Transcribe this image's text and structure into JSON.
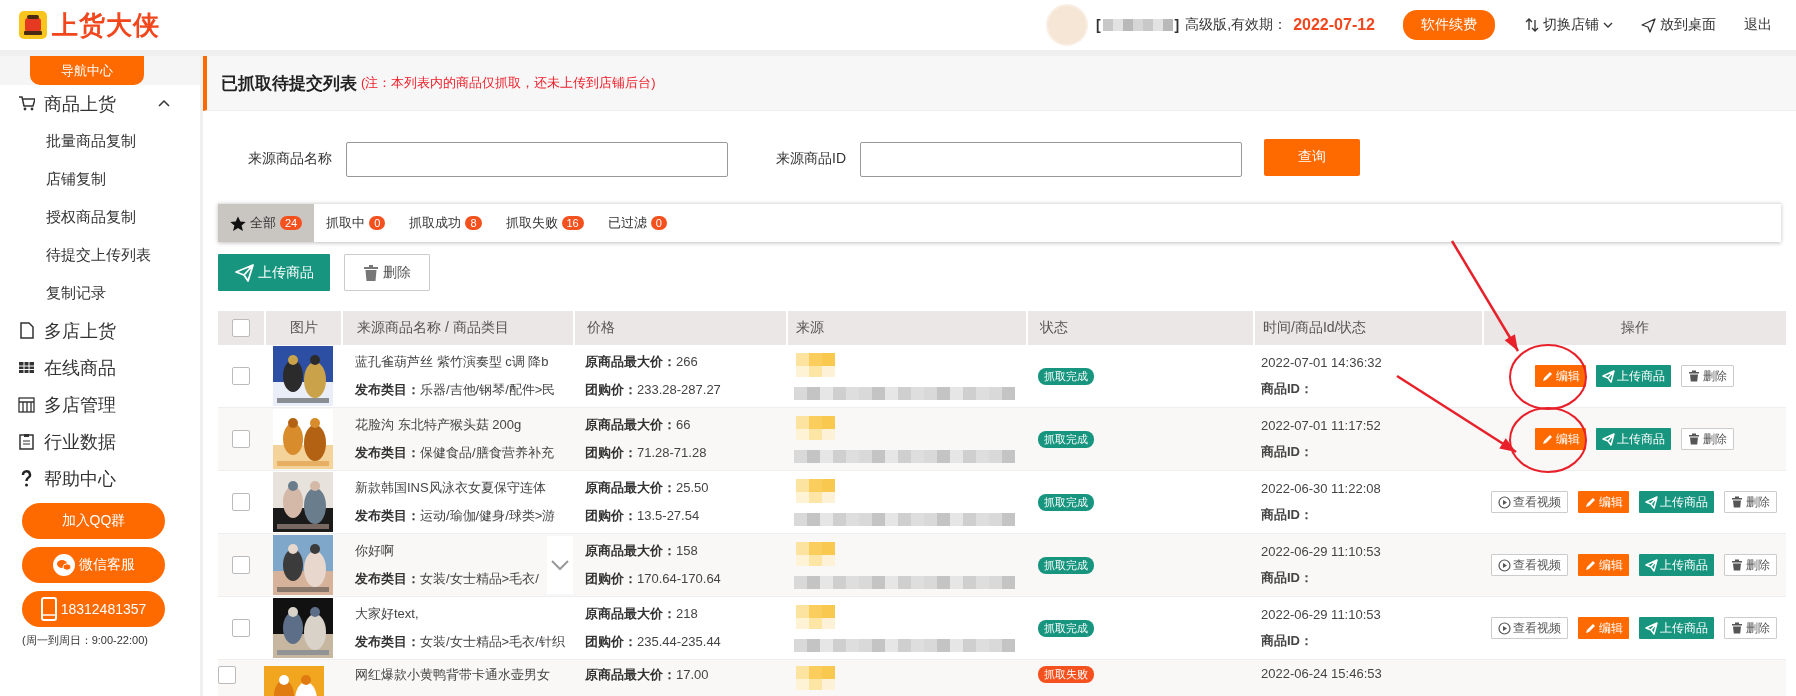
{
  "app": {
    "logo_text": "上货大侠"
  },
  "header": {
    "store_name": {
      "kind": "pixelated",
      "left": "[",
      "right": "]"
    },
    "plan_text": "高级版,有效期：",
    "expiry": "2022-07-12",
    "renew_button": "软件续费",
    "switch_store": "切换店铺",
    "pin_desktop": "放到桌面",
    "logout": "退出"
  },
  "sidebar": {
    "nav_tab": "导航中心",
    "items": [
      {
        "label": "商品上货",
        "expanded": true,
        "children": [
          {
            "label": "批量商品复制"
          },
          {
            "label": "店铺复制"
          },
          {
            "label": "授权商品复制"
          },
          {
            "label": "待提交上传列表"
          },
          {
            "label": "复制记录"
          }
        ]
      },
      {
        "label": "多店上货"
      },
      {
        "label": "在线商品"
      },
      {
        "label": "多店管理"
      },
      {
        "label": "行业数据"
      },
      {
        "label": "帮助中心"
      }
    ],
    "contact_buttons": [
      {
        "kind": "qq",
        "label": "加入QQ群"
      },
      {
        "kind": "wechat",
        "label": "微信客服"
      },
      {
        "kind": "phone",
        "label": "18312481357"
      }
    ],
    "hours": "(周一到周日：9:00-22:00)"
  },
  "page": {
    "title": "已抓取待提交列表",
    "note": "(注：本列表内的商品仅抓取，还未上传到店铺后台)"
  },
  "search": {
    "fields": [
      {
        "label": "来源商品名称"
      },
      {
        "label": "来源商品ID"
      }
    ],
    "button": "查询"
  },
  "filter_tabs": [
    {
      "label": "全部",
      "count": "24",
      "selected": true
    },
    {
      "label": "抓取中",
      "count": "0",
      "selected": false
    },
    {
      "label": "抓取成功",
      "count": "8",
      "selected": false
    },
    {
      "label": "抓取失败",
      "count": "16",
      "selected": false
    },
    {
      "label": "已过滤",
      "count": "0",
      "selected": false
    }
  ],
  "actions": [
    {
      "kind": "upload",
      "label": "上传商品"
    },
    {
      "kind": "delete",
      "label": "删除"
    }
  ],
  "table": {
    "header_checked": false,
    "columns": [
      "图片",
      "来源商品名称 / 商品类目",
      "价格",
      "来源",
      "状态",
      "时间/商品Id/状态",
      "操作"
    ],
    "rows": [
      {
        "checked": false,
        "image": {
          "kind": "picture"
        },
        "title": "蓝孔雀葫芦丝 紫竹演奏型 c调 降b",
        "category": "**发布类目：**乐器/吉他/钢琴/配件>民",
        "max_price": "**原商品最大价：**266",
        "group_price": "**团购价：**233.28-287.27",
        "source": {
          "kind": "pixelated"
        },
        "status": {
          "kind": "success",
          "label": "抓取完成"
        },
        "time": "2022-07-01 14:36:32",
        "product_id": "商品ID：",
        "annotated": true,
        "ops": [
          {
            "kind": "edit",
            "label": "编辑"
          },
          {
            "kind": "upload",
            "label": "上传商品"
          },
          {
            "kind": "delete",
            "label": "删除"
          }
        ]
      },
      {
        "checked": false,
        "image": {
          "kind": "picture"
        },
        "title": "花脸沟 东北特产猴头菇 200g",
        "category": "**发布类目：**保健食品/膳食营养补充",
        "max_price": "**原商品最大价：**66",
        "group_price": "**团购价：**71.28-71.28",
        "source": {
          "kind": "pixelated"
        },
        "status": {
          "kind": "success",
          "label": "抓取完成"
        },
        "time": "2022-07-01 11:17:52",
        "product_id": "商品ID：",
        "annotated": true,
        "ops": [
          {
            "kind": "edit",
            "label": "编辑"
          },
          {
            "kind": "upload",
            "label": "上传商品"
          },
          {
            "kind": "delete",
            "label": "删除"
          }
        ]
      },
      {
        "checked": false,
        "image": {
          "kind": "picture"
        },
        "title": "新款韩国INS风泳衣女夏保守连体",
        "category": "**发布类目：**运动/瑜伽/健身/球类>游",
        "max_price": "**原商品最大价：**25.50",
        "group_price": "**团购价：**13.5-27.54",
        "source": {
          "kind": "pixelated"
        },
        "status": {
          "kind": "success",
          "label": "抓取完成"
        },
        "time": "2022-06-30 11:22:08",
        "product_id": "商品ID：",
        "ops": [
          {
            "kind": "video",
            "label": "查看视频"
          },
          {
            "kind": "edit",
            "label": "编辑"
          },
          {
            "kind": "upload",
            "label": "上传商品"
          },
          {
            "kind": "delete",
            "label": "删除"
          }
        ]
      },
      {
        "checked": false,
        "image": {
          "kind": "picture"
        },
        "title": "你好啊",
        "category": "**发布类目：**女装/女士精品>毛衣/",
        "max_price": "**原商品最大价：**158",
        "group_price": "**团购价：**170.64-170.64",
        "source": {
          "kind": "pixelated"
        },
        "status": {
          "kind": "success",
          "label": "抓取完成"
        },
        "time": "2022-06-29 11:10:53",
        "product_id": "商品ID：",
        "chevron_overlay": true,
        "ops": [
          {
            "kind": "video",
            "label": "查看视频"
          },
          {
            "kind": "edit",
            "label": "编辑"
          },
          {
            "kind": "upload",
            "label": "上传商品"
          },
          {
            "kind": "delete",
            "label": "删除"
          }
        ]
      },
      {
        "checked": false,
        "image": {
          "kind": "picture"
        },
        "title": "大家好text,",
        "category": "**发布类目：**女装/女士精品>毛衣/针织",
        "max_price": "**原商品最大价：**218",
        "group_price": "**团购价：**235.44-235.44",
        "source": {
          "kind": "pixelated"
        },
        "status": {
          "kind": "success",
          "label": "抓取完成"
        },
        "time": "2022-06-29 11:10:53",
        "product_id": "商品ID：",
        "ops": [
          {
            "kind": "video",
            "label": "查看视频"
          },
          {
            "kind": "edit",
            "label": "编辑"
          },
          {
            "kind": "upload",
            "label": "上传商品"
          },
          {
            "kind": "delete",
            "label": "删除"
          }
        ]
      },
      {
        "checked": false,
        "image": {
          "kind": "picture"
        },
        "title": "网红爆款小黄鸭背带卡通水壶男女",
        "max_price": "**原商品最大价：**17.00",
        "source": {
          "kind": "pixelated_top"
        },
        "status": {
          "kind": "failed",
          "label": "抓取失败"
        },
        "time": "2022-06-24 15:46:53"
      }
    ]
  }
}
